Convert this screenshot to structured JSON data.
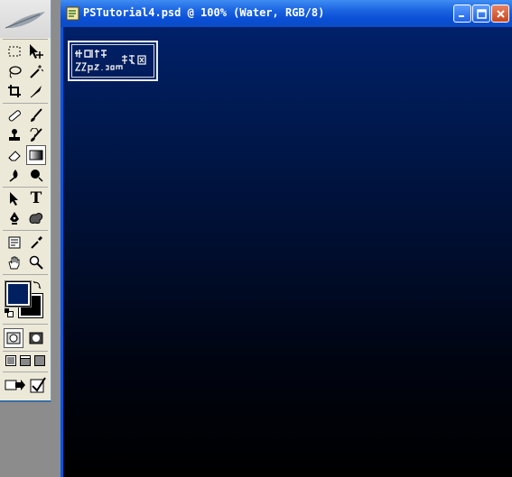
{
  "document": {
    "title": "PSTutorial4.psd @ 100% (Water, RGB/8)",
    "canvas_color_top": "#002069",
    "canvas_color_bottom": "#000000"
  },
  "toolbox": {
    "foreground_color": "#002060",
    "background_color": "#000000",
    "tools": [
      {
        "name": "rectangular-marquee-icon"
      },
      {
        "name": "move-icon"
      },
      {
        "name": "lasso-icon"
      },
      {
        "name": "magic-wand-icon"
      },
      {
        "name": "crop-icon"
      },
      {
        "name": "slice-icon"
      },
      {
        "name": "healing-brush-icon"
      },
      {
        "name": "brush-icon"
      },
      {
        "name": "clone-stamp-icon"
      },
      {
        "name": "history-brush-icon"
      },
      {
        "name": "eraser-icon"
      },
      {
        "name": "gradient-icon"
      },
      {
        "name": "blur-icon"
      },
      {
        "name": "dodge-icon"
      },
      {
        "name": "path-selection-icon"
      },
      {
        "name": "type-icon"
      },
      {
        "name": "pen-icon"
      },
      {
        "name": "custom-shape-icon"
      },
      {
        "name": "notes-icon"
      },
      {
        "name": "eyedropper-icon"
      },
      {
        "name": "hand-icon"
      },
      {
        "name": "zoom-icon"
      }
    ],
    "type_glyph": "T"
  }
}
